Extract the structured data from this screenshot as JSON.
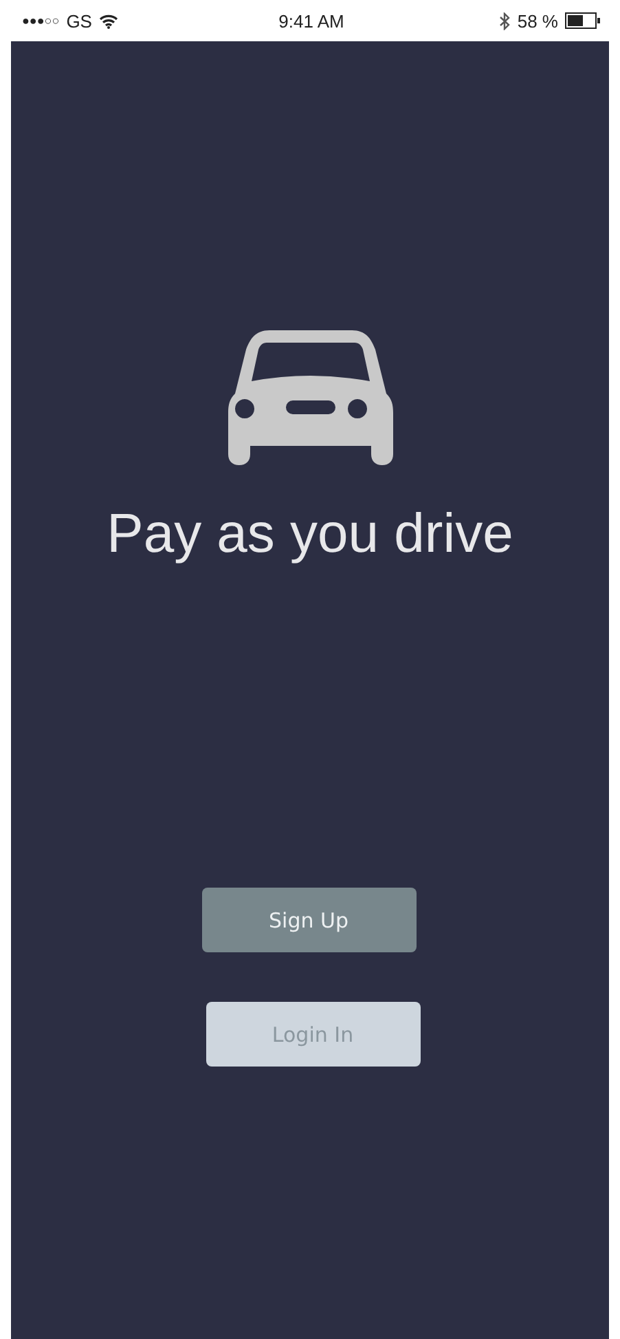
{
  "status_bar": {
    "signal_dots": "●●●○○",
    "carrier": "GS",
    "time": "9:41 AM",
    "battery_percent": "58 %"
  },
  "title": "Pay as you drive",
  "buttons": [
    {
      "label": "Sign Up",
      "kind": "primary"
    },
    {
      "label": "Login In",
      "kind": "secondary"
    }
  ]
}
